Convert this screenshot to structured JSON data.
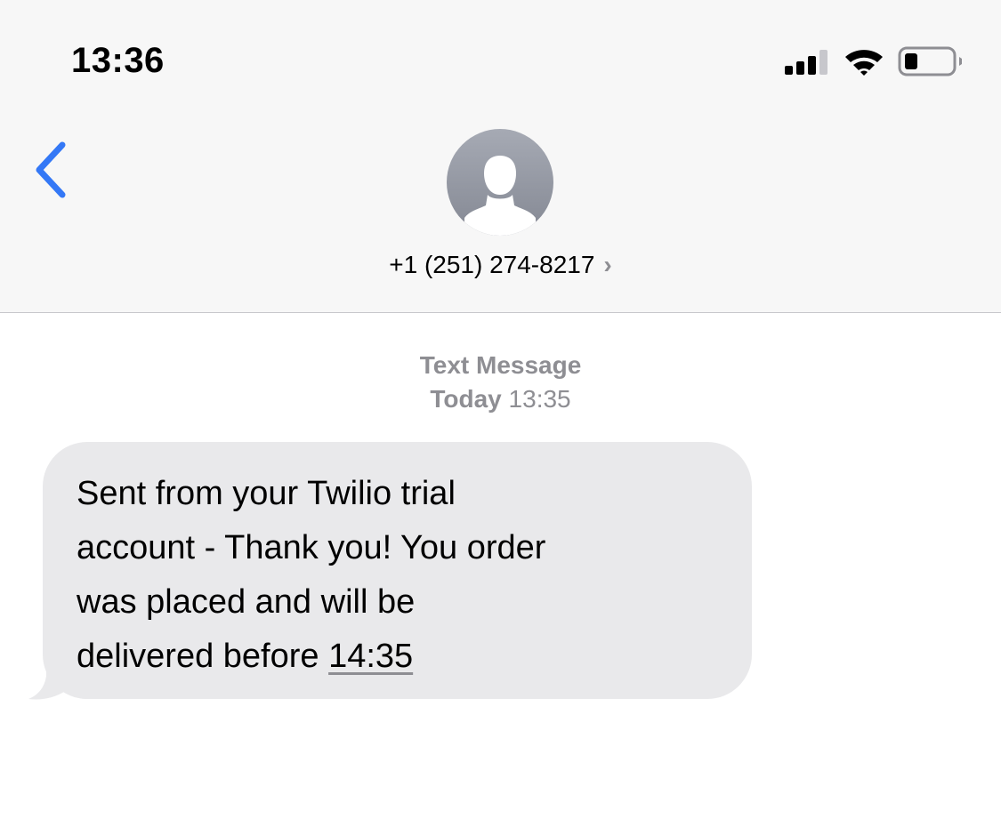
{
  "status_bar": {
    "time": "13:36",
    "signal_bars": 3,
    "signal_max": 4,
    "battery_level": 0.25,
    "icons": [
      "cellular-signal-icon",
      "wifi-icon",
      "battery-icon"
    ]
  },
  "nav": {
    "back_icon": "chevron-left-icon",
    "contact": "+1 (251) 274-8217",
    "contact_chevron": "›",
    "accent": "#3478f6"
  },
  "conversation": {
    "service": "Text Message",
    "day": "Today",
    "time": "13:35",
    "message": {
      "lines": [
        "Sent from your Twilio trial",
        "account - Thank you! You order",
        "was placed and will be",
        "delivered before "
      ],
      "link": "14:35",
      "bubble_color": "#e9e9eb"
    }
  }
}
